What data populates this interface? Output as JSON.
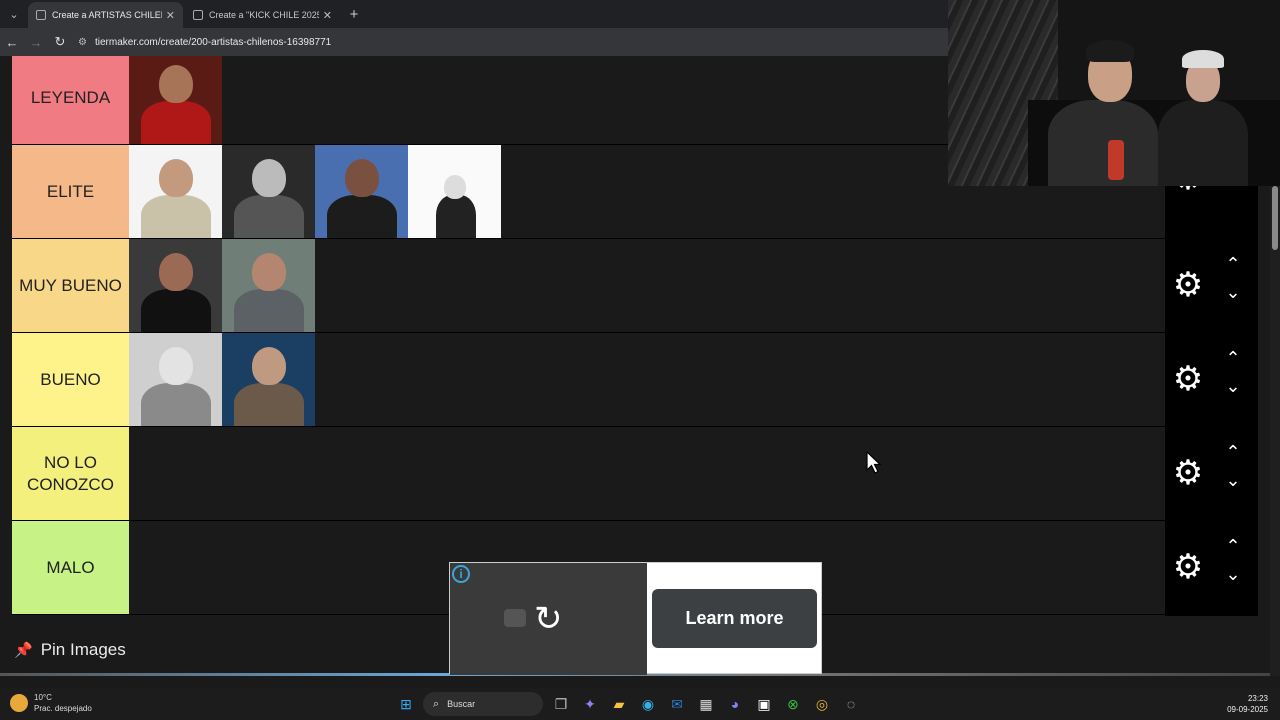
{
  "browser": {
    "tabs": [
      {
        "title": "Create a ARTISTAS CHILENOS T",
        "active": true
      },
      {
        "title": "Create a \"KICK CHILE 2025\" Tie",
        "active": false
      }
    ],
    "url": "tiermaker.com/create/200-artistas-chilenos-16398771"
  },
  "tiers": [
    {
      "label": "LEYENDA",
      "color": "#f07b82",
      "items": 1
    },
    {
      "label": "ELITE",
      "color": "#f5b888",
      "items": 4
    },
    {
      "label": "MUY BUENO",
      "color": "#f8d888",
      "items": 2
    },
    {
      "label": "BUENO",
      "color": "#fdf38a",
      "items": 2
    },
    {
      "label": "NO LO CONOZCO",
      "color": "#f4f07e",
      "items": 0
    },
    {
      "label": "MALO",
      "color": "#c7f285",
      "items": 0
    }
  ],
  "pin": {
    "label": "Pin Images"
  },
  "ad": {
    "button": "Learn more",
    "info": "i"
  },
  "taskbar": {
    "weather_temp": "10°C",
    "weather_desc": "Prac. despejado",
    "search_placeholder": "Buscar",
    "time": "23:23",
    "date": "09-09-2025"
  }
}
